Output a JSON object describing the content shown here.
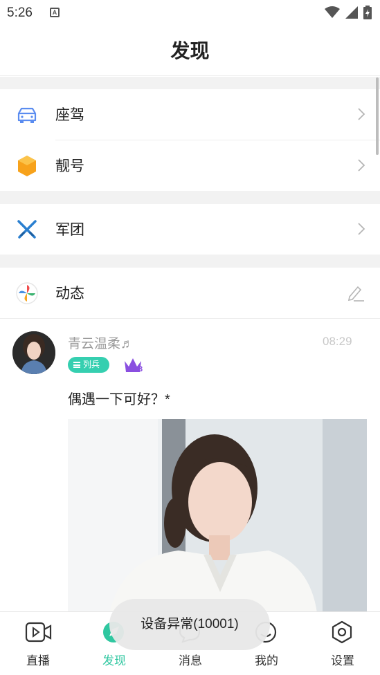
{
  "status_bar": {
    "time": "5:26",
    "notification_icon": "A"
  },
  "header": {
    "title": "发现"
  },
  "menu": {
    "items": [
      {
        "label": "座驾",
        "icon": "car-icon"
      },
      {
        "label": "靓号",
        "icon": "hexagon-gem-icon"
      },
      {
        "label": "军团",
        "icon": "crossed-swords-icon"
      },
      {
        "label": "动态",
        "icon": "pinwheel-icon",
        "action_icon": "edit-pencil-icon"
      }
    ]
  },
  "post": {
    "username": "青云温柔♬",
    "time": "08:29",
    "badge": "列兵",
    "crown_level": "3",
    "text": "偶遇一下可好？*"
  },
  "bottom_nav": {
    "items": [
      {
        "label": "直播",
        "icon": "video-icon"
      },
      {
        "label": "发现",
        "icon": "discover-icon",
        "active": true
      },
      {
        "label": "消息",
        "icon": "message-icon"
      },
      {
        "label": "我的",
        "icon": "profile-icon"
      },
      {
        "label": "设置",
        "icon": "settings-icon"
      }
    ]
  },
  "toast": "设备异常(10001)",
  "colors": {
    "accent": "#2fc7a0",
    "badge": "#35cfb0",
    "crown": "#8a4fe0",
    "separator": "#f2f2f2"
  }
}
